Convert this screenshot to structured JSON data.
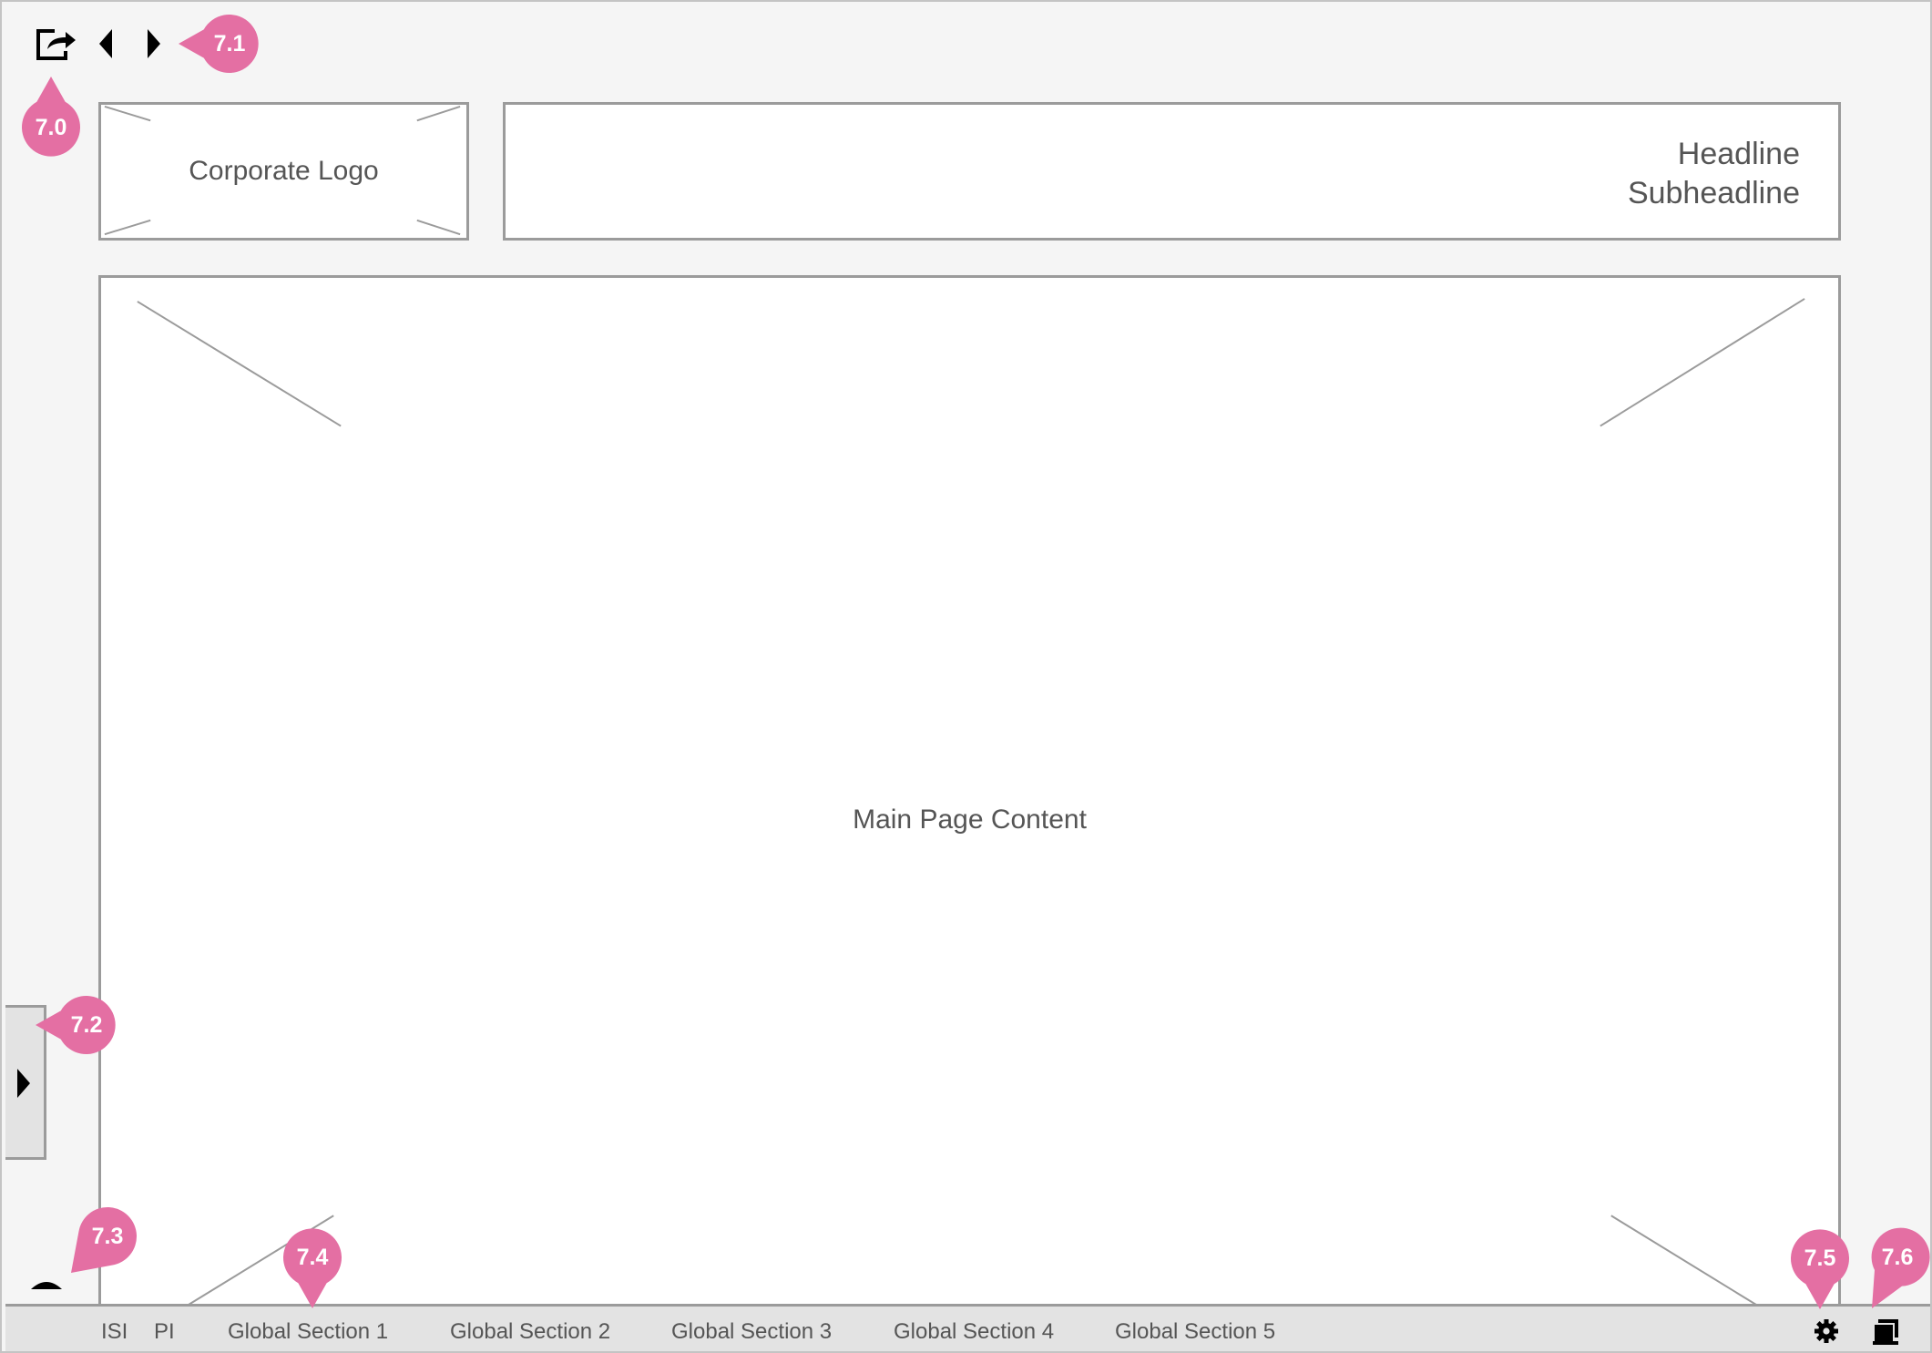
{
  "toolbar": {
    "exit_icon": "export-share-icon",
    "prev_icon": "previous-arrow-icon",
    "next_icon": "next-arrow-icon"
  },
  "header": {
    "logo_label": "Corporate Logo",
    "headline": "Headline",
    "subheadline": "Subheadline"
  },
  "main": {
    "content_label": "Main Page Content"
  },
  "side_panel": {
    "toggle_icon": "expand-right-icon"
  },
  "footer": {
    "scroll_top_icon": "caret-up-icon",
    "links": [
      "ISI",
      "PI",
      "Global Section 1",
      "Global Section 2",
      "Global Section 3",
      "Global Section 4",
      "Global Section 5"
    ],
    "settings_icon": "gear-icon",
    "windows_icon": "windows-icon"
  },
  "callouts": {
    "c70": "7.0",
    "c71": "7.1",
    "c72": "7.2",
    "c73": "7.3",
    "c74": "7.4",
    "c75": "7.5",
    "c76": "7.6"
  },
  "colors": {
    "callout": "#e46fa3",
    "border": "#9b9b9b",
    "background": "#f5f5f5",
    "bar": "#e3e3e3"
  }
}
